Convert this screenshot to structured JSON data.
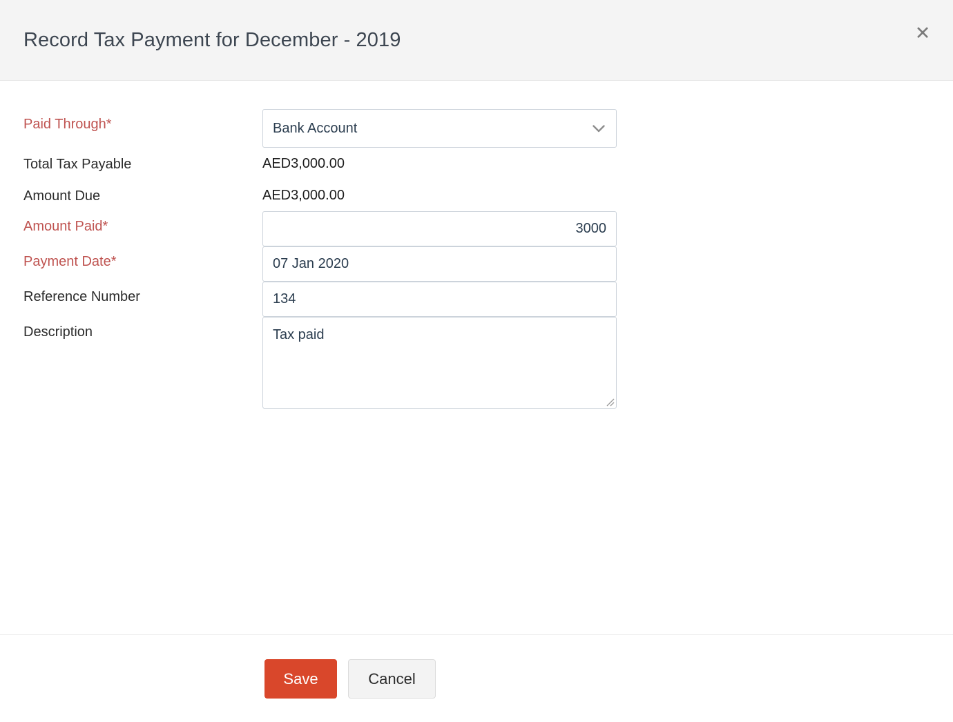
{
  "dialog": {
    "title": "Record Tax Payment for December - 2019",
    "close_icon": "close-icon",
    "close_glyph": "✕"
  },
  "form": {
    "paid_through": {
      "label": "Paid Through*",
      "value": "Bank Account",
      "dropdown_icon": "chevron-down-icon"
    },
    "total_tax_payable": {
      "label": "Total Tax Payable",
      "value": "AED3,000.00"
    },
    "amount_due": {
      "label": "Amount Due",
      "value": "AED3,000.00"
    },
    "amount_paid": {
      "label": "Amount Paid*",
      "value": "3000",
      "placeholder": ""
    },
    "payment_date": {
      "label": "Payment Date*",
      "value": "07 Jan 2020",
      "placeholder": ""
    },
    "reference_number": {
      "label": "Reference Number",
      "value": "134",
      "placeholder": ""
    },
    "description": {
      "label": "Description",
      "value": "Tax paid",
      "placeholder": "",
      "resize_icon": "resize-grip-icon"
    }
  },
  "footer": {
    "save_label": "Save",
    "cancel_label": "Cancel"
  },
  "colors": {
    "accent": "#d9472b",
    "required_label": "#bf5350",
    "header_bg": "#f4f4f4",
    "input_border": "#ccd3db",
    "text": "#2b2b2b"
  }
}
